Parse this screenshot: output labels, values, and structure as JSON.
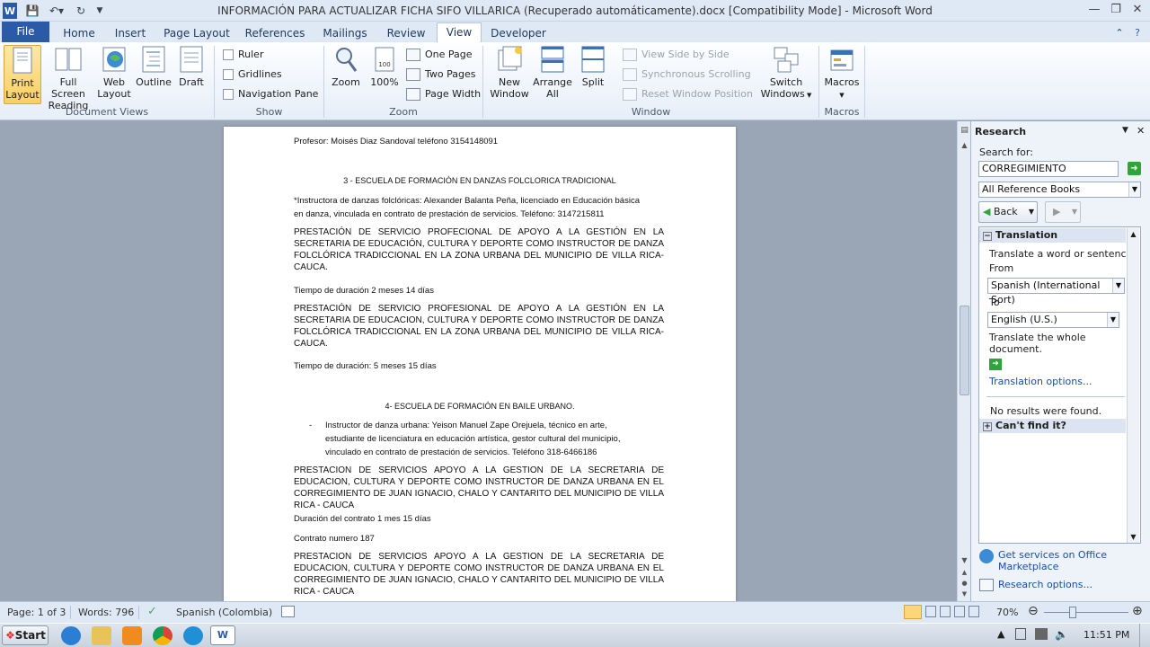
{
  "window": {
    "title": "INFORMACIÓN PARA ACTUALIZAR FICHA SIFO VILLARICA (Recuperado automáticamente).docx [Compatibility Mode] - Microsoft Word",
    "app_icon": "W"
  },
  "tabs": [
    "File",
    "Home",
    "Insert",
    "Page Layout",
    "References",
    "Mailings",
    "Review",
    "View",
    "Developer"
  ],
  "active_tab": "View",
  "ribbon": {
    "document_views": {
      "label": "Document Views",
      "buttons": [
        {
          "l1": "Print",
          "l2": "Layout"
        },
        {
          "l1": "Full Screen",
          "l2": "Reading"
        },
        {
          "l1": "Web",
          "l2": "Layout"
        },
        {
          "l1": "Outline",
          "l2": ""
        },
        {
          "l1": "Draft",
          "l2": ""
        }
      ]
    },
    "show": {
      "label": "Show",
      "items": [
        "Ruler",
        "Gridlines",
        "Navigation Pane"
      ]
    },
    "zoom": {
      "label": "Zoom",
      "zoom": "Zoom",
      "pct": "100%",
      "one_page": "One Page",
      "two_pages": "Two Pages",
      "page_width": "Page Width"
    },
    "window": {
      "label": "Window",
      "new_l1": "New",
      "new_l2": "Window",
      "arrange_l1": "Arrange",
      "arrange_l2": "All",
      "split": "Split",
      "side": "View Side by Side",
      "sync": "Synchronous Scrolling",
      "reset": "Reset Window Position",
      "switch_l1": "Switch",
      "switch_l2": "Windows"
    },
    "macros": {
      "label": "Macros",
      "btn": "Macros"
    }
  },
  "document": {
    "l1": "Profesor: Moisés Diaz Sandoval teléfono 3154148091",
    "h3": "3 - ESCUELA DE FORMACIÓN EN DANZAS FOLCLORICA TRADICIONAL",
    "l2": "*Instructora de danzas folclóricas: Alexander Balanta Peña, licenciado en Educación básica",
    "l3": "en danza, vinculada en contrato de prestación de servicios. Teléfono: 3147215811",
    "p1": "PRESTACIÓN DE SERVICIO PROFECIONAL DE APOYO A LA GESTIÓN EN LA SECRETARIA DE EDUCACIÓN, CULTURA Y DEPORTE COMO INSTRUCTOR DE DANZA FOLCLÓRICA TRADICCIONAL EN LA ZONA URBANA DEL MUNICIPIO DE VILLA RICA- CAUCA.",
    "t1": "Tiempo de duración 2 meses 14 días",
    "p2": "PRESTACIÓN DE SERVICIO PROFESIONAL DE APOYO A LA GESTIÓN EN LA SECRETARIA DE EDUCACION, CULTURA Y DEPORTE COMO INSTRUCTOR DE DANZA FOLCLÓRICA TRADICCIONAL EN LA ZONA URBANA DEL MUNICIPIO DE VILLA RICA- CAUCA.",
    "t2": "Tiempo de duración: 5 meses 15 días",
    "h4": "4- ESCUELA DE FORMACIÓN EN BAILE URBANO.",
    "b1": "Instructor de danza urbana: Yeison Manuel Zape Orejuela, técnico en arte,",
    "b2": "estudiante de licenciatura en educación artística, gestor cultural del municipio,",
    "b3": "vinculado en contrato de prestación de servicios. Teléfono 318-6466186",
    "p3": "PRESTACION DE SERVICIOS APOYO A LA GESTION DE LA SECRETARIA DE EDUCACION, CULTURA Y DEPORTE COMO INSTRUCTOR DE DANZA URBANA EN EL CORREGIMIENTO DE JUAN IGNACIO, CHALO Y CANTARITO DEL MUNICIPIO DE VILLA RICA - CAUCA",
    "t3": "Duración del contrato 1 mes 15 días",
    "t4": "Contrato numero 187",
    "p4": "PRESTACION DE SERVICIOS APOYO A LA GESTION DE LA SECRETARIA DE EDUCACION, CULTURA Y DEPORTE COMO INSTRUCTOR DE DANZA URBANA EN EL CORREGIMIENTO DE JUAN IGNACIO, CHALO Y CANTARITO DEL MUNICIPIO DE VILLA RICA - CAUCA"
  },
  "research": {
    "title": "Research",
    "search_for": "Search for:",
    "query": "CORREGIMIENTO",
    "source": "All Reference Books",
    "back": "Back",
    "translation": "Translation",
    "translate_word": "Translate a word or sentence.",
    "from": "From",
    "from_lang": "Spanish (International Sort)",
    "to": "To",
    "to_lang": "English (U.S.)",
    "translate_doc": "Translate the whole document.",
    "translation_options": "Translation options...",
    "no_results": "No results were found.",
    "cant_find": "Can't find it?",
    "get_services": "Get services on Office Marketplace",
    "research_options": "Research options..."
  },
  "status": {
    "page": "Page: 1 of 3",
    "words": "Words: 796",
    "language": "Spanish (Colombia)",
    "zoom": "70%"
  },
  "taskbar": {
    "start": "Start",
    "time": "11:51 PM"
  }
}
